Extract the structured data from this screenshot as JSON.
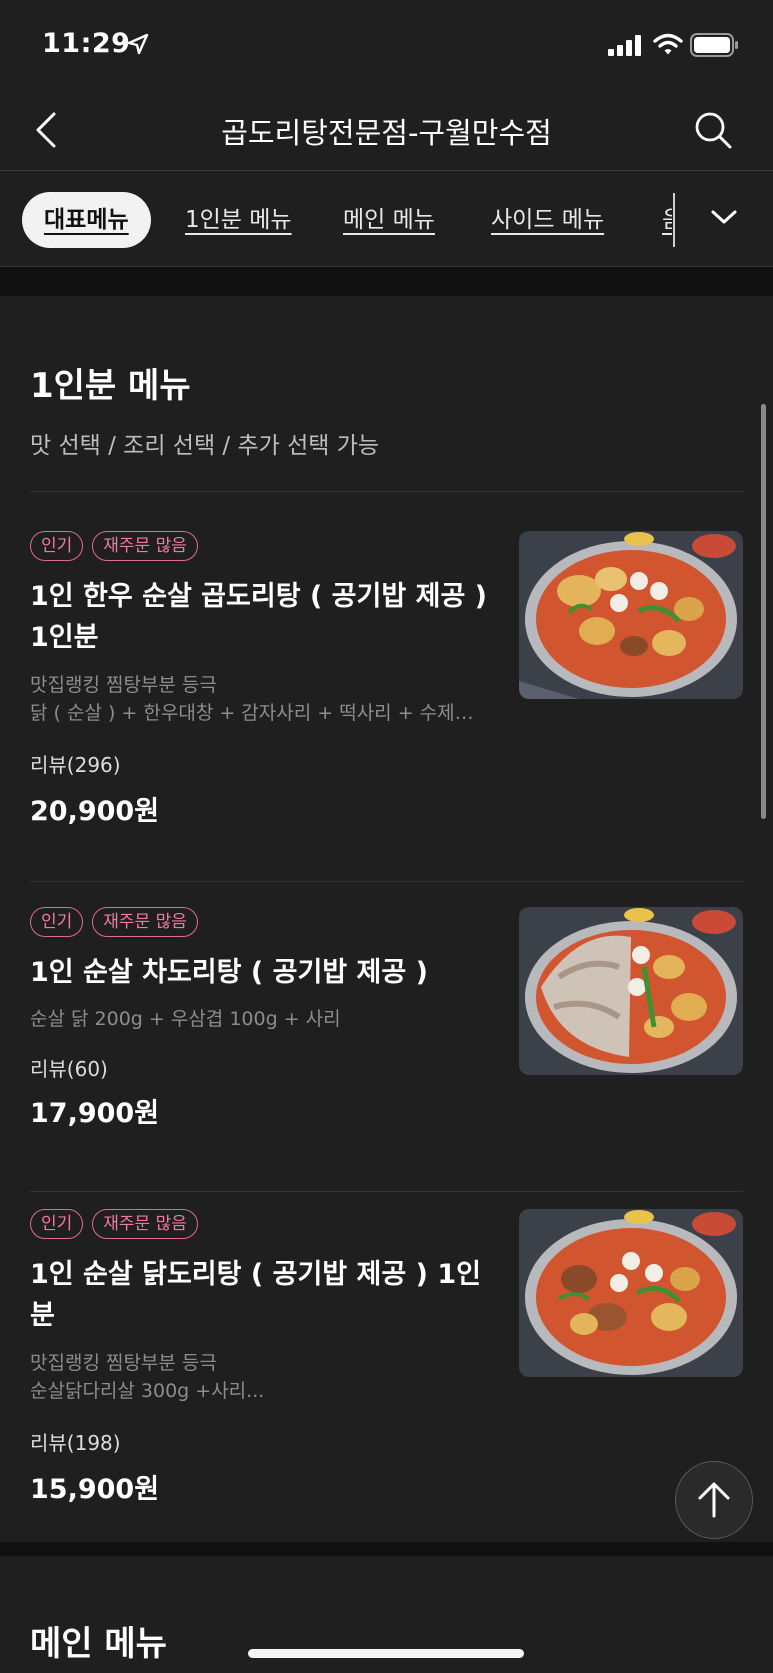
{
  "status_bar": {
    "time": "11:29"
  },
  "nav": {
    "title": "곱도리탕전문점-구월만수점"
  },
  "tabs": [
    {
      "label": "대표메뉴",
      "active": true
    },
    {
      "label": "1인분 메뉴"
    },
    {
      "label": "메인 메뉴"
    },
    {
      "label": "사이드 메뉴"
    },
    {
      "label": "음"
    }
  ],
  "section": {
    "title": "1인분 메뉴",
    "description": "맛 선택 / 조리 선택 / 추가 선택 가능",
    "items": [
      {
        "badges": [
          "인기",
          "재주문 많음"
        ],
        "name": "1인 한우 순살 곱도리탕 ( 공기밥 제공 ) 1인분",
        "desc_lines": [
          "맛집랭킹 찜탕부분 등극",
          "닭 ( 순살 ) + 한우대창 + 감자사리 + 떡사리 + 수제…"
        ],
        "review": "리뷰(296)",
        "price": "20,900원",
        "image": "braised-chicken-hot-pot-with-tripe"
      },
      {
        "badges": [
          "인기",
          "재주문 많음"
        ],
        "name": "1인 순살 차도리탕 (  공기밥 제공  )",
        "desc_lines": [
          "순살 닭 200g  +  우삼겹 100g  +  사리"
        ],
        "review": "리뷰(60)",
        "price": "17,900원",
        "image": "chicken-and-beef-brisket-hot-pot"
      },
      {
        "badges": [
          "인기",
          "재주문 많음"
        ],
        "name": "1인 순살 닭도리탕 ( 공기밥 제공 ) 1인분",
        "desc_lines": [
          "맛집랭킹 찜탕부분 등극",
          "순살닭다리살 300g +사리..."
        ],
        "review": "리뷰(198)",
        "price": "15,900원",
        "image": "braised-spicy-chicken-hot-pot"
      }
    ]
  },
  "section2": {
    "title": "메인 메뉴"
  },
  "colors": {
    "background": "#1f1f20",
    "badge": "#e36a8f",
    "divider": "#333333"
  },
  "icons": [
    "location-arrow-icon",
    "signal-icon",
    "wifi-icon",
    "battery-icon",
    "back-chevron-icon",
    "search-icon",
    "chevron-down-icon",
    "arrow-up-icon"
  ]
}
